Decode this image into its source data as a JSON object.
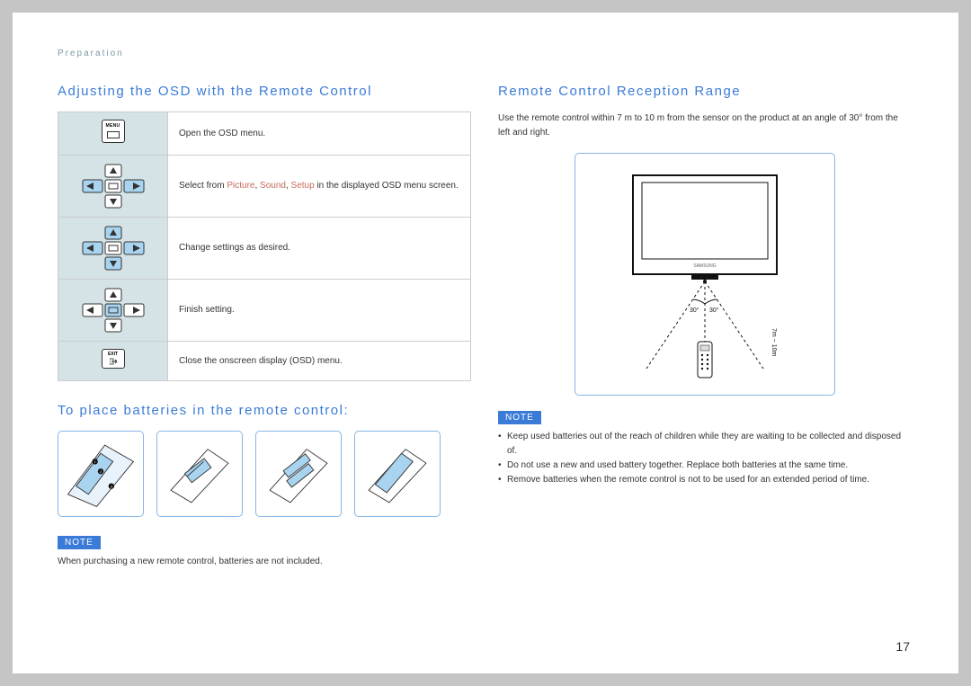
{
  "breadcrumb": "Preparation",
  "sections": {
    "osd": {
      "title": "Adjusting the OSD with the Remote Control",
      "rows": [
        {
          "icon": "menu",
          "text": "Open the OSD menu."
        },
        {
          "icon": "dpad-lr",
          "text_pre": "Select from ",
          "hl1": "Picture",
          "sep1": ", ",
          "hl2": "Sound",
          "sep2": ", ",
          "hl3": "Setup",
          "text_post": " in the displayed OSD menu screen."
        },
        {
          "icon": "dpad-all",
          "text": "Change settings as desired."
        },
        {
          "icon": "dpad-center",
          "text": "Finish setting."
        },
        {
          "icon": "exit",
          "text": "Close the onscreen display (OSD) menu."
        }
      ]
    },
    "batteries": {
      "title": "To place batteries in the remote control:",
      "note_label": "NOTE",
      "note_text": "When purchasing a new remote control, batteries are not included."
    },
    "range": {
      "title": "Remote Control Reception Range",
      "body": "Use the remote control within 7 m to 10 m from the sensor on the product at an angle of 30° from the left and right.",
      "angle_left": "30°",
      "angle_right": "30°",
      "distance": "7m ~ 10m",
      "note_label": "NOTE",
      "notes": [
        "Keep used batteries out of the reach of children while they are waiting to be collected and disposed of.",
        "Do not use a new and used battery together. Replace both batteries at the same time.",
        "Remove batteries when the remote control is not to be used for an extended period of time."
      ]
    }
  },
  "page_number": "17",
  "brand": "SAMSUNG"
}
